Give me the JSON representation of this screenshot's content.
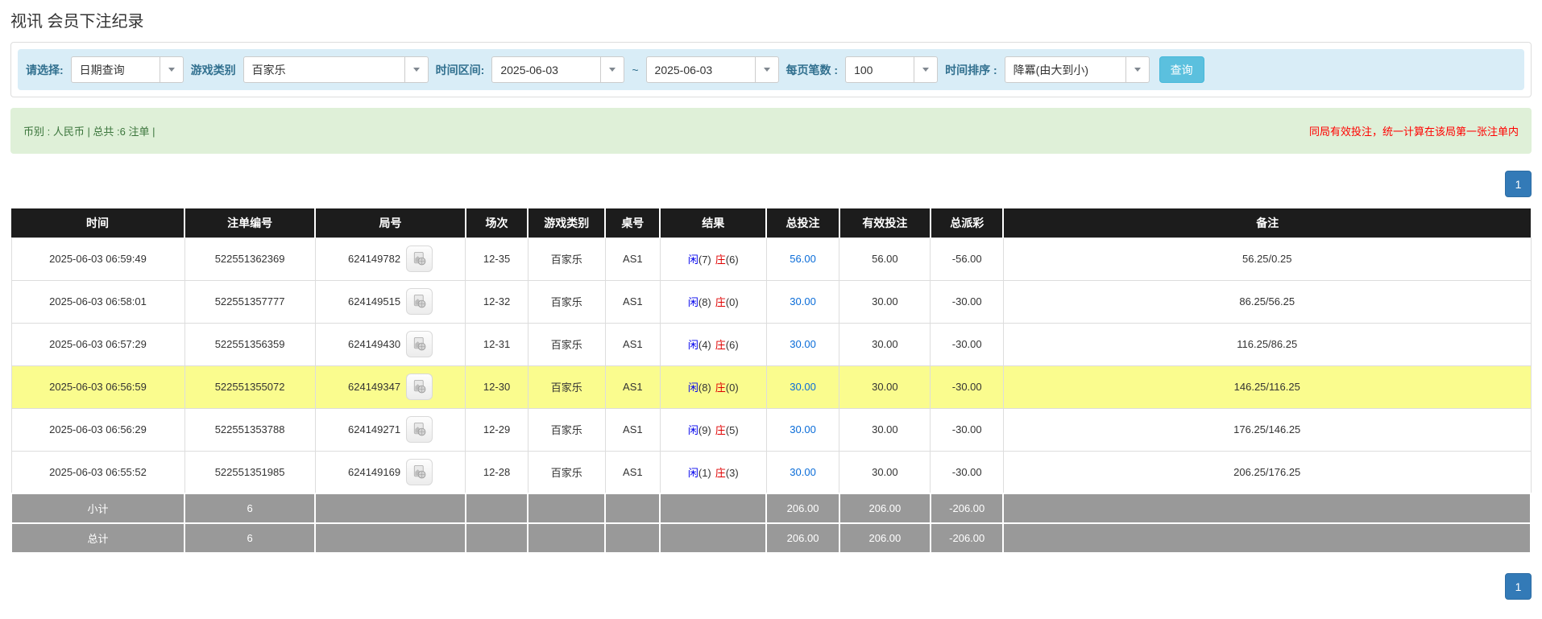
{
  "page": {
    "title": "视讯 会员下注纪录"
  },
  "filters": {
    "select_label": "请选择:",
    "select_value": "日期查询",
    "game_label": "游戏类别",
    "game_value": "百家乐",
    "range_label": "时间区间:",
    "date_from": "2025-06-03",
    "tilde": "~",
    "date_to": "2025-06-03",
    "per_page_label": "每页笔数 :",
    "per_page_value": "100",
    "sort_label": "时间排序 :",
    "sort_value": "降冪(由大到小)",
    "query_button": "查询"
  },
  "summary": {
    "left": "币别 : 人民币 | 总共 :6 注单 |",
    "right_note": "同局有效投注，统一计算在该局第一张注单内"
  },
  "pagination": {
    "page": "1"
  },
  "icons": {
    "combo_caret": "chevron-down-icon",
    "video": "film-replay-icon"
  },
  "colors": {
    "filter_bar_bg": "#d9edf7",
    "filter_label": "#31708f",
    "query_button_bg": "#5bc0de",
    "summary_bg": "#dff0d8",
    "summary_text": "#3c763d",
    "note_red": "#ff0000",
    "header_bg": "#1c1c1c",
    "highlight_row": "#fafc8e",
    "player_blue": "#0000ee",
    "banker_red": "#e00000",
    "bet_link_blue": "#0a6cd8",
    "payout_red": "#ff0000",
    "sum_row_bg": "#999999",
    "pagination_bg": "#337ab7"
  },
  "table": {
    "headers": [
      "时间",
      "注单编号",
      "局号",
      "场次",
      "游戏类别",
      "桌号",
      "结果",
      "总投注",
      "有效投注",
      "总派彩",
      "备注"
    ],
    "rows": [
      {
        "time": "2025-06-03 06:59:49",
        "bet_id": "522551362369",
        "round": "624149782",
        "session": "12-35",
        "game": "百家乐",
        "table_no": "AS1",
        "player_label": "闲",
        "player_score": "(7)",
        "banker_label": "庄",
        "banker_score": "(6)",
        "total_bet": "56.00",
        "valid_bet": "56.00",
        "payout": "-56.00",
        "note": "56.25/0.25",
        "highlight": false
      },
      {
        "time": "2025-06-03 06:58:01",
        "bet_id": "522551357777",
        "round": "624149515",
        "session": "12-32",
        "game": "百家乐",
        "table_no": "AS1",
        "player_label": "闲",
        "player_score": "(8)",
        "banker_label": "庄",
        "banker_score": "(0)",
        "total_bet": "30.00",
        "valid_bet": "30.00",
        "payout": "-30.00",
        "note": "86.25/56.25",
        "highlight": false
      },
      {
        "time": "2025-06-03 06:57:29",
        "bet_id": "522551356359",
        "round": "624149430",
        "session": "12-31",
        "game": "百家乐",
        "table_no": "AS1",
        "player_label": "闲",
        "player_score": "(4)",
        "banker_label": "庄",
        "banker_score": "(6)",
        "total_bet": "30.00",
        "valid_bet": "30.00",
        "payout": "-30.00",
        "note": "116.25/86.25",
        "highlight": false
      },
      {
        "time": "2025-06-03 06:56:59",
        "bet_id": "522551355072",
        "round": "624149347",
        "session": "12-30",
        "game": "百家乐",
        "table_no": "AS1",
        "player_label": "闲",
        "player_score": "(8)",
        "banker_label": "庄",
        "banker_score": "(0)",
        "total_bet": "30.00",
        "valid_bet": "30.00",
        "payout": "-30.00",
        "note": "146.25/116.25",
        "highlight": true
      },
      {
        "time": "2025-06-03 06:56:29",
        "bet_id": "522551353788",
        "round": "624149271",
        "session": "12-29",
        "game": "百家乐",
        "table_no": "AS1",
        "player_label": "闲",
        "player_score": "(9)",
        "banker_label": "庄",
        "banker_score": "(5)",
        "total_bet": "30.00",
        "valid_bet": "30.00",
        "payout": "-30.00",
        "note": "176.25/146.25",
        "highlight": false
      },
      {
        "time": "2025-06-03 06:55:52",
        "bet_id": "522551351985",
        "round": "624149169",
        "session": "12-28",
        "game": "百家乐",
        "table_no": "AS1",
        "player_label": "闲",
        "player_score": "(1)",
        "banker_label": "庄",
        "banker_score": "(3)",
        "total_bet": "30.00",
        "valid_bet": "30.00",
        "payout": "-30.00",
        "note": "206.25/176.25",
        "highlight": false
      }
    ],
    "subtotal": {
      "label": "小计",
      "count": "6",
      "total_bet": "206.00",
      "valid_bet": "206.00",
      "payout": "-206.00"
    },
    "total": {
      "label": "总计",
      "count": "6",
      "total_bet": "206.00",
      "valid_bet": "206.00",
      "payout": "-206.00"
    }
  }
}
